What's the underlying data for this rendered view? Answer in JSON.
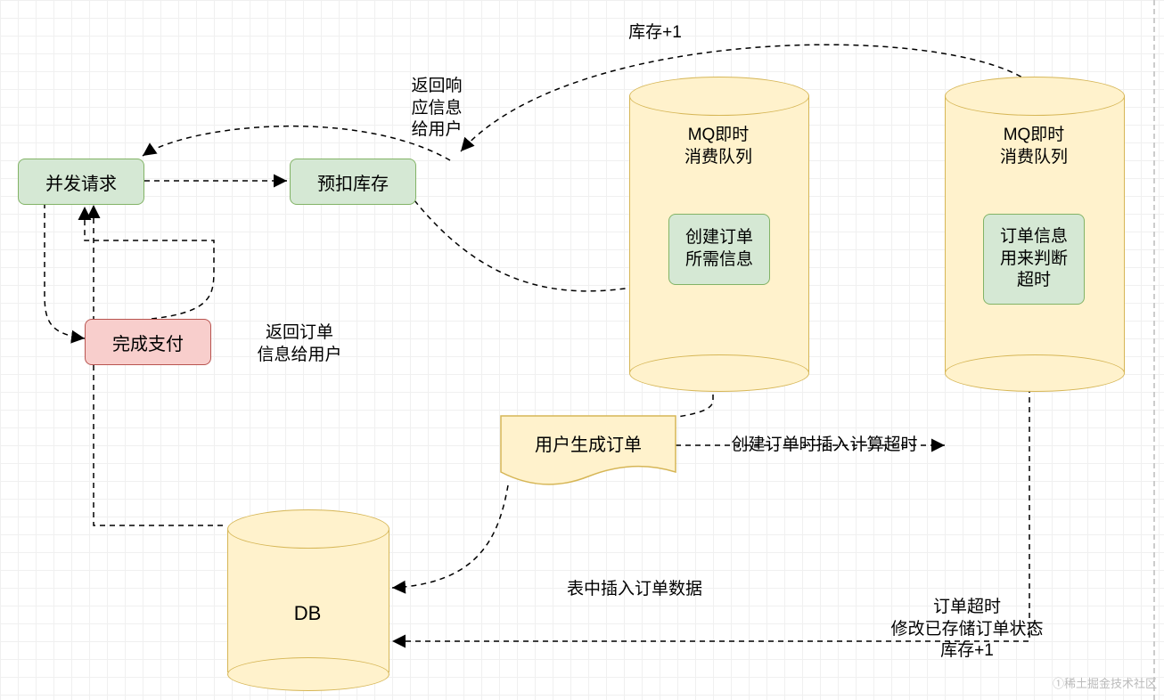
{
  "nodes": {
    "concurrent_request": "并发请求",
    "pre_deduct_stock": "预扣库存",
    "complete_payment": "完成支付",
    "user_create_order": "用户生成订单",
    "db": "DB",
    "mq1_title": "MQ即时\n消费队列",
    "mq1_inner": "创建订单\n所需信息",
    "mq2_title": "MQ即时\n消费队列",
    "mq2_inner": "订单信息\n用来判断\n超时"
  },
  "edges": {
    "stock_plus_1": "库存+1",
    "return_response": "返回响\n应信息\n给用户",
    "return_order_info": "返回订单\n信息给用户",
    "create_order_timeout": "创建订单时插入计算超时",
    "insert_order_data": "表中插入订单数据",
    "order_timeout_update": "订单超时\n修改已存储订单状态\n库存+1"
  },
  "watermark": "①稀土掘金技术社区"
}
